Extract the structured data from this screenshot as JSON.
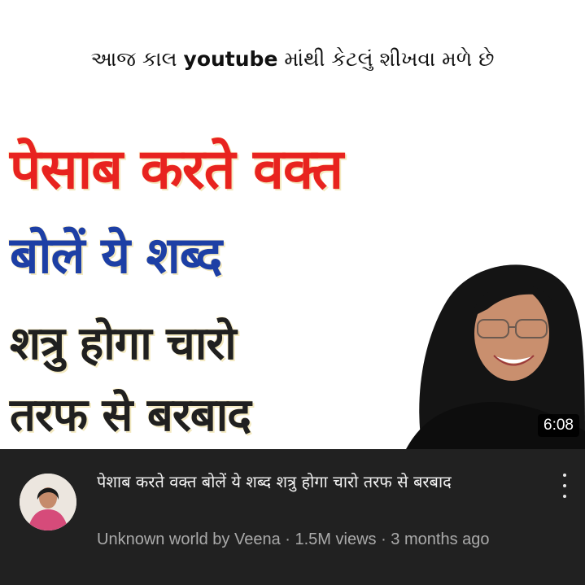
{
  "caption": {
    "prefix": "આજ કાલ ",
    "bold": "youtube",
    "suffix": " માંથી કેટલું શીખવા મળે છે"
  },
  "thumbnail": {
    "line1": "पेसाब करते वक्त",
    "line2": "बोलें ये शब्द",
    "line3": "शत्रु होगा चारो",
    "line4": "तरफ से बरबाद",
    "duration": "6:08",
    "colors": {
      "line1": "#e8231f",
      "line2": "#1d3fa5",
      "line34": "#202020"
    }
  },
  "video": {
    "title": "पेशाब करते वक्त बोलें ये शब्द शत्रु होगा चारो तरफ से बरबाद",
    "channel": "Unknown world by Veena",
    "views": "1.5M views",
    "age": "3 months ago",
    "separator": " · ",
    "more_icon": "more-vertical-icon"
  }
}
